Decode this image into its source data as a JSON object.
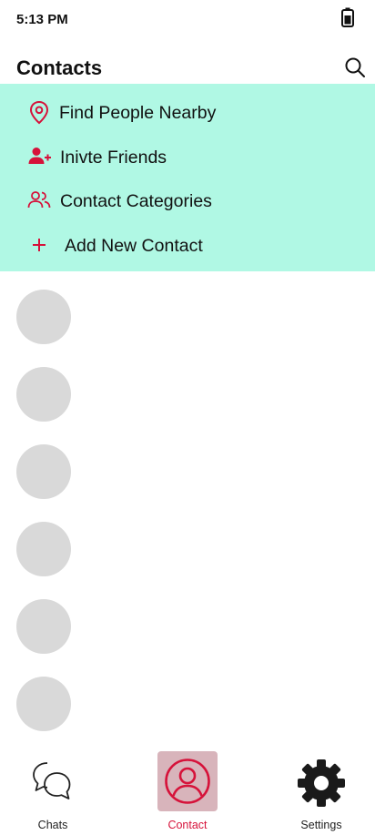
{
  "status_bar": {
    "time": "5:13 PM",
    "battery_icon": "battery-icon"
  },
  "header": {
    "title": "Contacts",
    "search_icon": "search-icon"
  },
  "menu": {
    "background": "#b0f8e4",
    "accent": "#d6123a",
    "items": [
      {
        "label": "Find People Nearby",
        "icon": "location-pin-icon"
      },
      {
        "label": "Inivte Friends",
        "icon": "add-user-icon"
      },
      {
        "label": "Contact Categories",
        "icon": "users-group-icon"
      },
      {
        "label": "Add New Contact",
        "icon": "plus-icon"
      }
    ]
  },
  "contacts": {
    "avatar_count": 6,
    "avatar_color": "#d9d9d9"
  },
  "bottom_nav": {
    "items": [
      {
        "label": "Chats",
        "icon": "chat-bubbles-icon",
        "active": false
      },
      {
        "label": "Contact",
        "icon": "user-circle-icon",
        "active": true
      },
      {
        "label": "Settings",
        "icon": "gear-icon",
        "active": false
      }
    ],
    "active_color": "#d6123a",
    "active_background": "#d8b4bb"
  }
}
